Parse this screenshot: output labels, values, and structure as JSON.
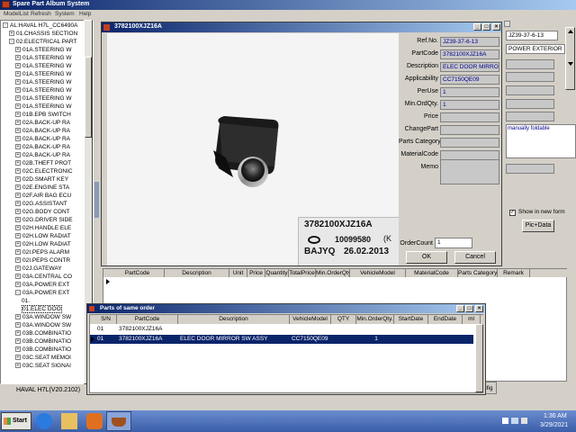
{
  "app": {
    "title": "Spare Part Album System",
    "menu": [
      "ModelList",
      "Refresh",
      "System",
      "Help"
    ]
  },
  "tree": {
    "root": "AL:HAVAL H7L_CC6490A",
    "items": [
      {
        "label": "01.CHASSIS SECTION",
        "indent": 1,
        "expand": "+"
      },
      {
        "label": "02.ELECTRICAL PART",
        "indent": 1,
        "expand": "-"
      },
      {
        "label": "01A.STEERING W",
        "indent": 2,
        "expand": "+"
      },
      {
        "label": "01A.STEERING W",
        "indent": 2,
        "expand": "+"
      },
      {
        "label": "01A.STEERING W",
        "indent": 2,
        "expand": "+"
      },
      {
        "label": "01A.STEERING W",
        "indent": 2,
        "expand": "+"
      },
      {
        "label": "01A.STEERING W",
        "indent": 2,
        "expand": "+"
      },
      {
        "label": "01A.STEERING W",
        "indent": 2,
        "expand": "+"
      },
      {
        "label": "01A.STEERING W",
        "indent": 2,
        "expand": "+"
      },
      {
        "label": "01A.STEERING W",
        "indent": 2,
        "expand": "+"
      },
      {
        "label": "01B.EPB SWITCH",
        "indent": 2,
        "expand": "+"
      },
      {
        "label": "02A.BACK-UP RA",
        "indent": 2,
        "expand": "+"
      },
      {
        "label": "02A.BACK-UP RA",
        "indent": 2,
        "expand": "+"
      },
      {
        "label": "02A.BACK-UP RA",
        "indent": 2,
        "expand": "+"
      },
      {
        "label": "02A.BACK-UP RA",
        "indent": 2,
        "expand": "+"
      },
      {
        "label": "02A.BACK-UP RA",
        "indent": 2,
        "expand": "+"
      },
      {
        "label": "02B.THEFT PROT",
        "indent": 2,
        "expand": "+"
      },
      {
        "label": "02C.ELECTRONIC",
        "indent": 2,
        "expand": "+"
      },
      {
        "label": "02D.SMART KEY",
        "indent": 2,
        "expand": "+"
      },
      {
        "label": "02E.ENGINE STA",
        "indent": 2,
        "expand": "+"
      },
      {
        "label": "02F.AIR BAG ECU",
        "indent": 2,
        "expand": "+"
      },
      {
        "label": "02G.ASSISTANT",
        "indent": 2,
        "expand": "+"
      },
      {
        "label": "02G.BODY CONT",
        "indent": 2,
        "expand": "+"
      },
      {
        "label": "02G.DRIVER SIDE",
        "indent": 2,
        "expand": "+"
      },
      {
        "label": "02H.HANDLE ELE",
        "indent": 2,
        "expand": "+"
      },
      {
        "label": "02H.LOW RADIAT",
        "indent": 2,
        "expand": "+"
      },
      {
        "label": "02H.LOW RADIAT",
        "indent": 2,
        "expand": "+"
      },
      {
        "label": "02I.PEPS ALARM",
        "indent": 2,
        "expand": "+"
      },
      {
        "label": "02I.PEPS CONTR",
        "indent": 2,
        "expand": "+"
      },
      {
        "label": "02J.GATEWAY",
        "indent": 2,
        "expand": "+"
      },
      {
        "label": "03A.CENTRAL CO",
        "indent": 2,
        "expand": "+"
      },
      {
        "label": "03A.POWER EXT",
        "indent": 2,
        "expand": "+"
      },
      {
        "label": "03A.POWER EXT",
        "indent": 2,
        "expand": "-"
      },
      {
        "label": "01.",
        "indent": 3,
        "expand": ""
      },
      {
        "label": "01.ELEC DOO",
        "indent": 3,
        "expand": ""
      },
      {
        "label": "03A.WINDOW SW",
        "indent": 2,
        "expand": "+"
      },
      {
        "label": "03A.WINDOW SW",
        "indent": 2,
        "expand": "+"
      },
      {
        "label": "03B.COMBINATIO",
        "indent": 2,
        "expand": "+"
      },
      {
        "label": "03B.COMBINATIO",
        "indent": 2,
        "expand": "+"
      },
      {
        "label": "03B.COMBINATIO",
        "indent": 2,
        "expand": "+"
      },
      {
        "label": "03C.SEAT MEMOI",
        "indent": 2,
        "expand": "+"
      },
      {
        "label": "03C.SEAT SIGNAI",
        "indent": 2,
        "expand": "+"
      }
    ]
  },
  "status_version": "HAVAL H7L(V20.2102)",
  "detail_dialog": {
    "title": "3782100XJZ16A",
    "fields": [
      {
        "label": "Ref.No.",
        "value": "JZ39-37-6-13"
      },
      {
        "label": "PartCode",
        "value": "3782100XJZ16A"
      },
      {
        "label": "Description",
        "value": "ELEC DOOR MIRROR S"
      },
      {
        "label": "Applicability",
        "value": "CC7150QE09"
      },
      {
        "label": "PerUse",
        "value": "1"
      },
      {
        "label": "Min.OrdQty.",
        "value": "1"
      },
      {
        "label": "Price",
        "value": ""
      },
      {
        "label": "ChangePart",
        "value": ""
      },
      {
        "label": "Parts Category",
        "value": ""
      },
      {
        "label": "MaterialCode",
        "value": ""
      },
      {
        "label": "Memo",
        "value": ""
      }
    ],
    "order_count_label": "OrderCount",
    "order_count_value": "1",
    "ok_label": "OK",
    "cancel_label": "Cancel",
    "photo_label_code": "3782100XJZ16A",
    "photo_label_num": "10099580",
    "photo_label_brand": "BAJYQ",
    "photo_label_date": "26.02.2013",
    "photo_label_mark": "(K"
  },
  "right_panel": {
    "ref_value": "JZ39-37-6-13",
    "name_value": "POWER EXTERIOR R",
    "memo_value": "manually foldable",
    "show_new_form_label": "Show in new form",
    "pic_data_label": "Pic+Data",
    "config_label": "nfig"
  },
  "main_table": {
    "columns": [
      "PartCode",
      "Description",
      "Unit",
      "Price",
      "Quantity",
      "TotalPrice",
      "Min.OrderQty.",
      "VehicleModel",
      "MaterialCode",
      "Parts Category",
      "Remark"
    ]
  },
  "parts_dialog": {
    "title": "Parts of same order",
    "columns": [
      "S/N",
      "PartCode",
      "Description",
      "VehicleModel",
      "QTY",
      "Min.OrderQty.",
      "StartDate",
      "EndDate",
      "ml"
    ],
    "rows": [
      {
        "sn": "01",
        "partcode": "3782100XJZ16A",
        "description": "",
        "model": "",
        "qty": "",
        "min": "",
        "start": "",
        "end": "",
        "ml": "",
        "selected": false
      },
      {
        "sn": "01",
        "partcode": "3782100XJZ16A",
        "description": "ELEC DOOR MIRROR SW ASSY",
        "model": "CC7150QE09",
        "qty": "",
        "min": "1",
        "start": "",
        "end": "",
        "ml": "",
        "selected": true
      }
    ]
  },
  "taskbar": {
    "start_label": "Start",
    "time": "1:36 AM",
    "date": "3/29/2021"
  }
}
